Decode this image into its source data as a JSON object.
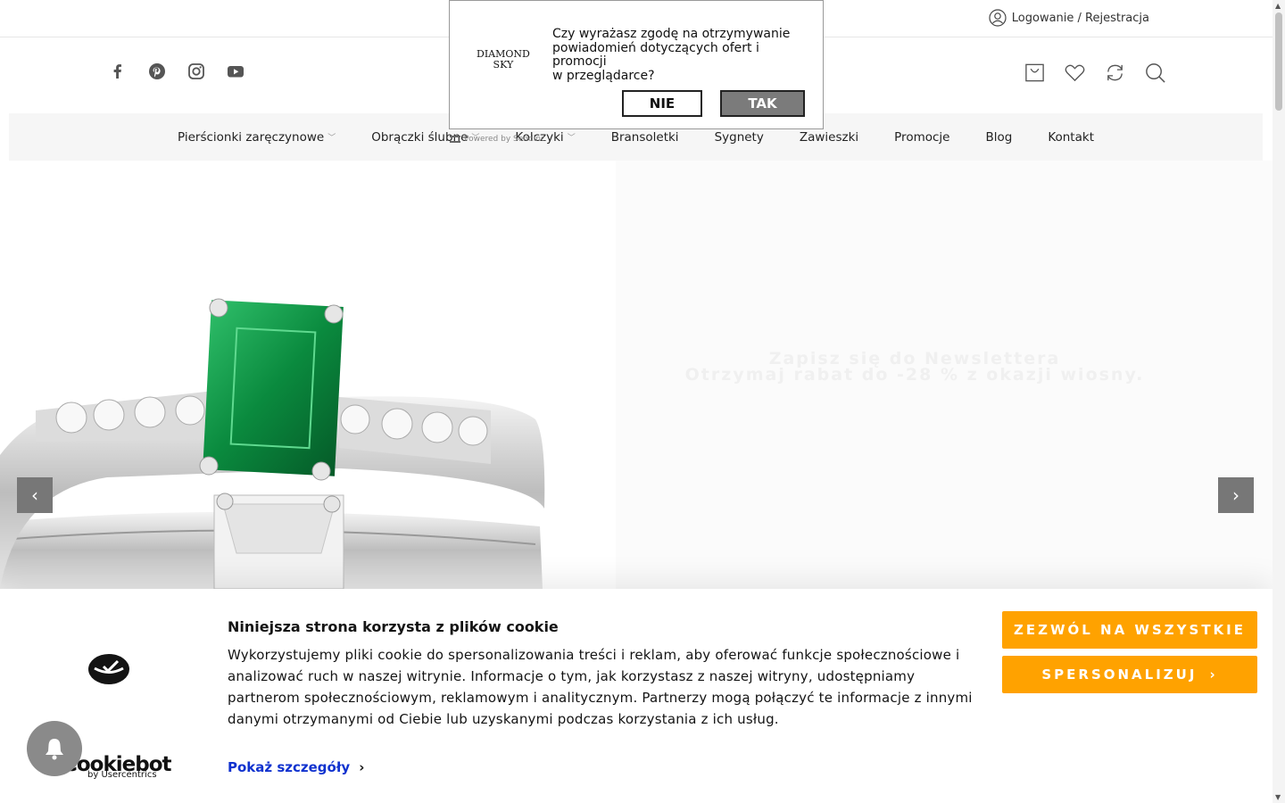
{
  "topbar": {
    "login_label": "Logowanie / Rejestracja"
  },
  "social": [
    "facebook-icon",
    "pinterest-icon",
    "instagram-icon",
    "youtube-icon"
  ],
  "header_icons": [
    "cart-icon",
    "heart-icon",
    "compare-icon",
    "search-icon"
  ],
  "nav": {
    "items": [
      {
        "label": "Pierścionki zaręczynowe",
        "has_dropdown": true
      },
      {
        "label": "Obrączki ślubne",
        "has_dropdown": true
      },
      {
        "label": "Kolczyki",
        "has_dropdown": true
      },
      {
        "label": "Bransoletki",
        "has_dropdown": false
      },
      {
        "label": "Sygnety",
        "has_dropdown": false
      },
      {
        "label": "Zawieszki",
        "has_dropdown": false
      },
      {
        "label": "Promocje",
        "has_dropdown": false
      },
      {
        "label": "Blog",
        "has_dropdown": false
      },
      {
        "label": "Kontakt",
        "has_dropdown": false
      }
    ]
  },
  "hero": {
    "line1": "Zapisz się do Newslettera",
    "line2": "Otrzymaj rabat do -28 % z okazji wiosny."
  },
  "push_popup": {
    "logo_line1": "DIAMOND",
    "logo_line2": "SKY",
    "message_line1": "Czy wyrażasz zgodę na otrzymywanie powiadomień dotyczących ofert i promocji",
    "message_line2": "w przeglądarce?",
    "no_label": "NIE",
    "yes_label": "TAK",
    "powered_label": "Powered by Sendinc"
  },
  "cookie": {
    "title": "Niniejsza strona korzysta z plików cookie",
    "body": "Wykorzystujemy pliki cookie do spersonalizowania treści i reklam, aby oferować funkcje społecznościowe i analizować ruch w naszej witrynie. Informacje o tym, jak korzystasz z naszej witryny, udostępniamy partnerom społecznościowym, reklamowym i analitycznym. Partnerzy mogą połączyć te informacje z innymi danymi otrzymanymi od Ciebie lub uzyskanymi podczas korzystania z ich usług.",
    "details_label": "Pokaż szczegóły",
    "allow_label": "ZEZWÓL NA WSZYSTKIE",
    "customize_label": "SPERSONALIZUJ",
    "brand": "Cookiebot",
    "brand_sub": "by Usercentrics",
    "accent_color": "#ffa200",
    "link_color": "#1032cf"
  }
}
